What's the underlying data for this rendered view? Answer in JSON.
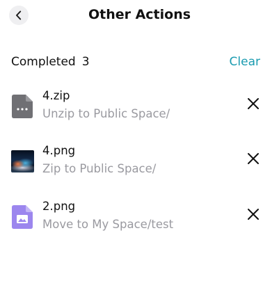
{
  "header": {
    "title": "Other Actions",
    "back_icon": "chevron-left-icon"
  },
  "section": {
    "label": "Completed",
    "count": "3",
    "clear_label": "Clear",
    "accent_color": "#1a9bb0"
  },
  "items": [
    {
      "name": "4.zip",
      "action": "Unzip to Public Space/",
      "icon": "archive-file-icon",
      "icon_color": "#707074"
    },
    {
      "name": "4.png",
      "action": "Zip to Public Space/",
      "icon": "image-thumbnail",
      "icon_color": "#132a4a"
    },
    {
      "name": "2.png",
      "action": "Move to My Space/test",
      "icon": "image-file-icon",
      "icon_color": "#9c86ee"
    }
  ],
  "row_close_icon": "close-icon"
}
